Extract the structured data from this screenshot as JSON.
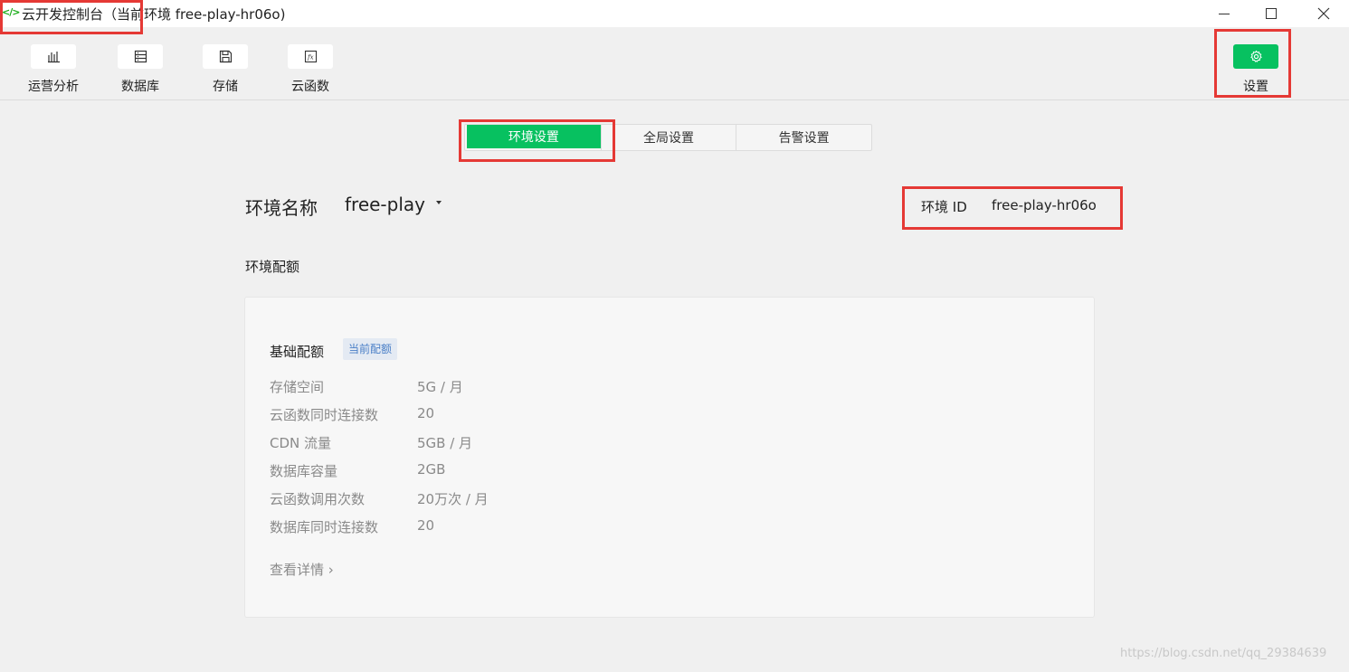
{
  "window": {
    "app_icon": "</>",
    "title": "云开发控制台（当前环境 free-play-hr06o)"
  },
  "toolbar": {
    "items": [
      {
        "label": "运营分析",
        "icon": "bar-chart-icon"
      },
      {
        "label": "数据库",
        "icon": "database-icon"
      },
      {
        "label": "存储",
        "icon": "save-icon"
      },
      {
        "label": "云函数",
        "icon": "function-icon"
      }
    ],
    "settings": {
      "label": "设置",
      "icon": "gear-icon"
    }
  },
  "tabs": [
    {
      "label": "环境设置",
      "active": true
    },
    {
      "label": "全局设置",
      "active": false
    },
    {
      "label": "告警设置",
      "active": false
    }
  ],
  "environment": {
    "name_label": "环境名称",
    "name_value": "free-play",
    "id_label": "环境 ID",
    "id_value": "free-play-hr06o"
  },
  "quota": {
    "section_title": "环境配额",
    "title": "基础配额",
    "badge": "当前配额",
    "rows": [
      {
        "key": "存储空间",
        "value": "5G / 月"
      },
      {
        "key": "云函数同时连接数",
        "value": "20"
      },
      {
        "key": "CDN 流量",
        "value": "5GB / 月"
      },
      {
        "key": "数据库容量",
        "value": "2GB"
      },
      {
        "key": "云函数调用次数",
        "value": "20万次 / 月"
      },
      {
        "key": "数据库同时连接数",
        "value": "20"
      }
    ],
    "details_link": "查看详情 ›"
  },
  "watermark": "https://blog.csdn.net/qq_29384639",
  "colors": {
    "accent": "#07c160",
    "highlight_box": "#e53935",
    "badge_text": "#4a7fc7"
  }
}
